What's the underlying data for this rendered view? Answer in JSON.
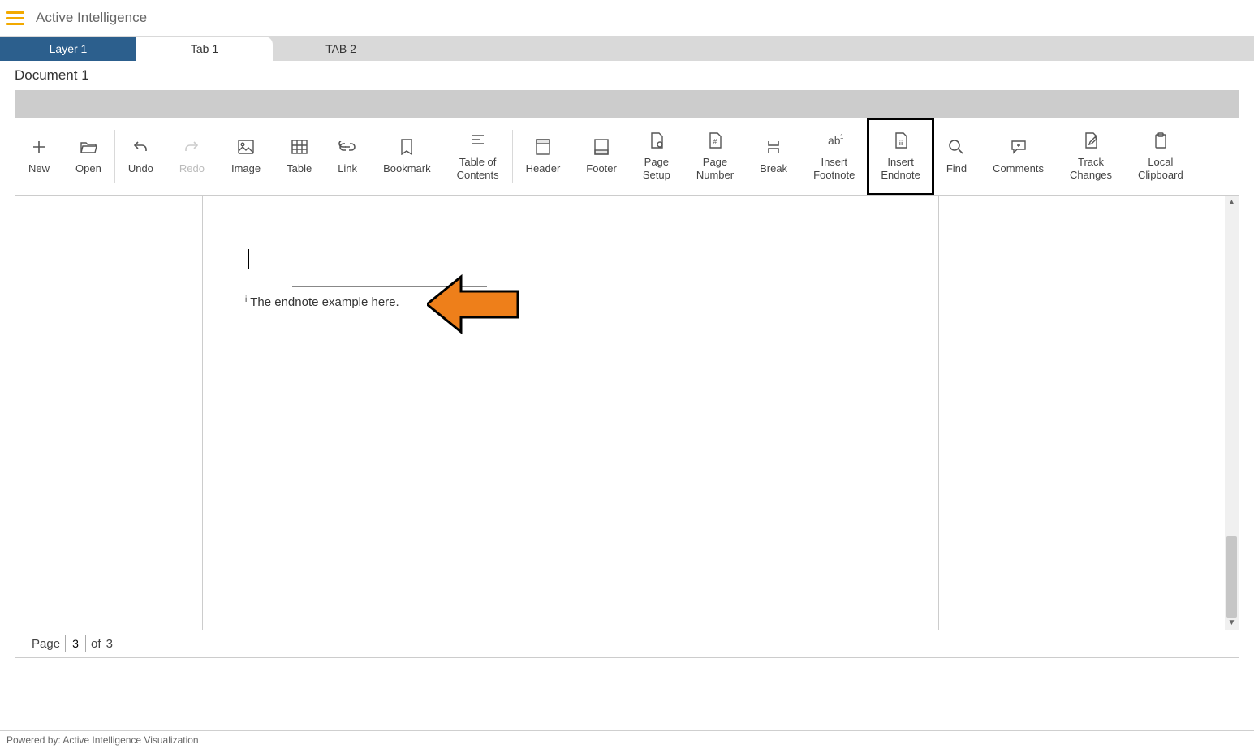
{
  "brand": {
    "title": "Active Intelligence"
  },
  "tabs": [
    {
      "label": "Layer 1"
    },
    {
      "label": "Tab 1"
    },
    {
      "label": "TAB 2"
    }
  ],
  "document": {
    "title": "Document 1"
  },
  "ribbon": {
    "new": "New",
    "open": "Open",
    "undo": "Undo",
    "redo": "Redo",
    "image": "Image",
    "table": "Table",
    "link": "Link",
    "bookmark": "Bookmark",
    "toc1": "Table of",
    "toc2": "Contents",
    "header": "Header",
    "footer": "Footer",
    "pagesetup1": "Page",
    "pagesetup2": "Setup",
    "pagenum1": "Page",
    "pagenum2": "Number",
    "break": "Break",
    "insfoot1": "Insert",
    "insfoot2": "Footnote",
    "insend1": "Insert",
    "insend2": "Endnote",
    "find": "Find",
    "comments": "Comments",
    "track1": "Track",
    "track2": "Changes",
    "clip1": "Local",
    "clip2": "Clipboard"
  },
  "content": {
    "endnote_marker": "i",
    "endnote_text": "The endnote example here."
  },
  "pager": {
    "label_page": "Page",
    "current": "3",
    "label_of": "of",
    "total": "3"
  },
  "footer": {
    "text": "Powered by: Active Intelligence Visualization"
  }
}
